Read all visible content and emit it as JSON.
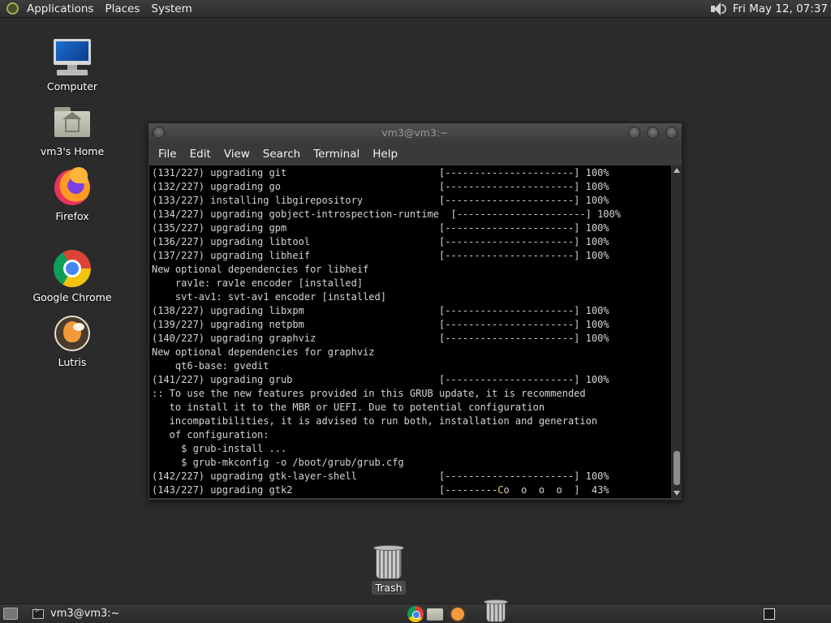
{
  "top_panel": {
    "menus": [
      "Applications",
      "Places",
      "System"
    ],
    "clock": "Fri May 12, 07:37"
  },
  "desktop_icons": {
    "computer": "Computer",
    "home": "vm3's Home",
    "firefox": "Firefox",
    "chrome": "Google Chrome",
    "lutris": "Lutris",
    "trash": "Trash"
  },
  "terminal": {
    "title": "vm3@vm3:~",
    "menus": [
      "File",
      "Edit",
      "View",
      "Search",
      "Terminal",
      "Help"
    ],
    "lines": [
      "(131/227) upgrading git                          [----------------------] 100%",
      "(132/227) upgrading go                           [----------------------] 100%",
      "(133/227) installing libgirepository             [----------------------] 100%",
      "(134/227) upgrading gobject-introspection-runtime  [----------------------] 100%",
      "(135/227) upgrading gpm                          [----------------------] 100%",
      "(136/227) upgrading libtool                      [----------------------] 100%",
      "(137/227) upgrading libheif                      [----------------------] 100%",
      "New optional dependencies for libheif",
      "    rav1e: rav1e encoder [installed]",
      "    svt-av1: svt-av1 encoder [installed]",
      "(138/227) upgrading libxpm                       [----------------------] 100%",
      "(139/227) upgrading netpbm                       [----------------------] 100%",
      "(140/227) upgrading graphviz                     [----------------------] 100%",
      "New optional dependencies for graphviz",
      "    qt6-base: gvedit",
      "(141/227) upgrading grub                         [----------------------] 100%",
      ":: To use the new features provided in this GRUB update, it is recommended",
      "   to install it to the MBR or UEFI. Due to potential configuration",
      "   incompatibilities, it is advised to run both, installation and generation",
      "   of configuration:",
      "     $ grub-install ...",
      "     $ grub-mkconfig -o /boot/grub/grub.cfg",
      "(142/227) upgrading gtk-layer-shell              [----------------------] 100%"
    ],
    "progress_line": {
      "prefix": "(143/227) upgrading gtk2                         [---------",
      "cursor": "C",
      "suffix": "o  o  o  o  ]  43%"
    }
  },
  "bottom_panel": {
    "task_label": "vm3@vm3:~"
  }
}
